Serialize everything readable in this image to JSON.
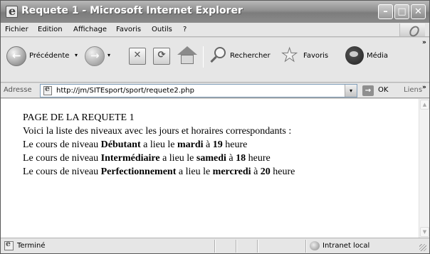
{
  "window": {
    "title": "Requete 1 - Microsoft Internet Explorer",
    "minimize_glyph": "–",
    "maximize_glyph": "□",
    "close_glyph": "✕"
  },
  "menu": {
    "items": [
      "Fichier",
      "Edition",
      "Affichage",
      "Favoris",
      "Outils",
      "?"
    ]
  },
  "toolbar": {
    "back_label": "Précédente",
    "back_glyph": "←",
    "forward_glyph": "→",
    "dropdown_glyph": "▾",
    "stop_glyph": "✕",
    "refresh_glyph": "⟳",
    "search_label": "Rechercher",
    "favorites_label": "Favoris",
    "media_label": "Média",
    "more_glyph": "»"
  },
  "address": {
    "label": "Adresse",
    "url": "http://jm/SITEsport/sport/requete2.php",
    "dropdown_glyph": "▾",
    "go_glyph": "→",
    "go_label": "OK",
    "links_label": "Liens",
    "more_glyph": "»"
  },
  "content": {
    "heading": "PAGE DE LA REQUETE 1",
    "intro": "Voici la liste des niveaux avec les jours et horaires correspondants :",
    "line_prefix": "Le cours de niveau",
    "has_place": "a lieu le",
    "at": "à",
    "hour_word": "heure",
    "courses": [
      {
        "level": "Débutant",
        "day": "mardi",
        "hour": "19"
      },
      {
        "level": "Intermédiaire",
        "day": "samedi",
        "hour": "18"
      },
      {
        "level": "Perfectionnement",
        "day": "mercredi",
        "hour": "20"
      }
    ]
  },
  "scrollbar": {
    "up_glyph": "▲",
    "down_glyph": "▼"
  },
  "status": {
    "text": "Terminé",
    "zone": "Intranet local"
  }
}
